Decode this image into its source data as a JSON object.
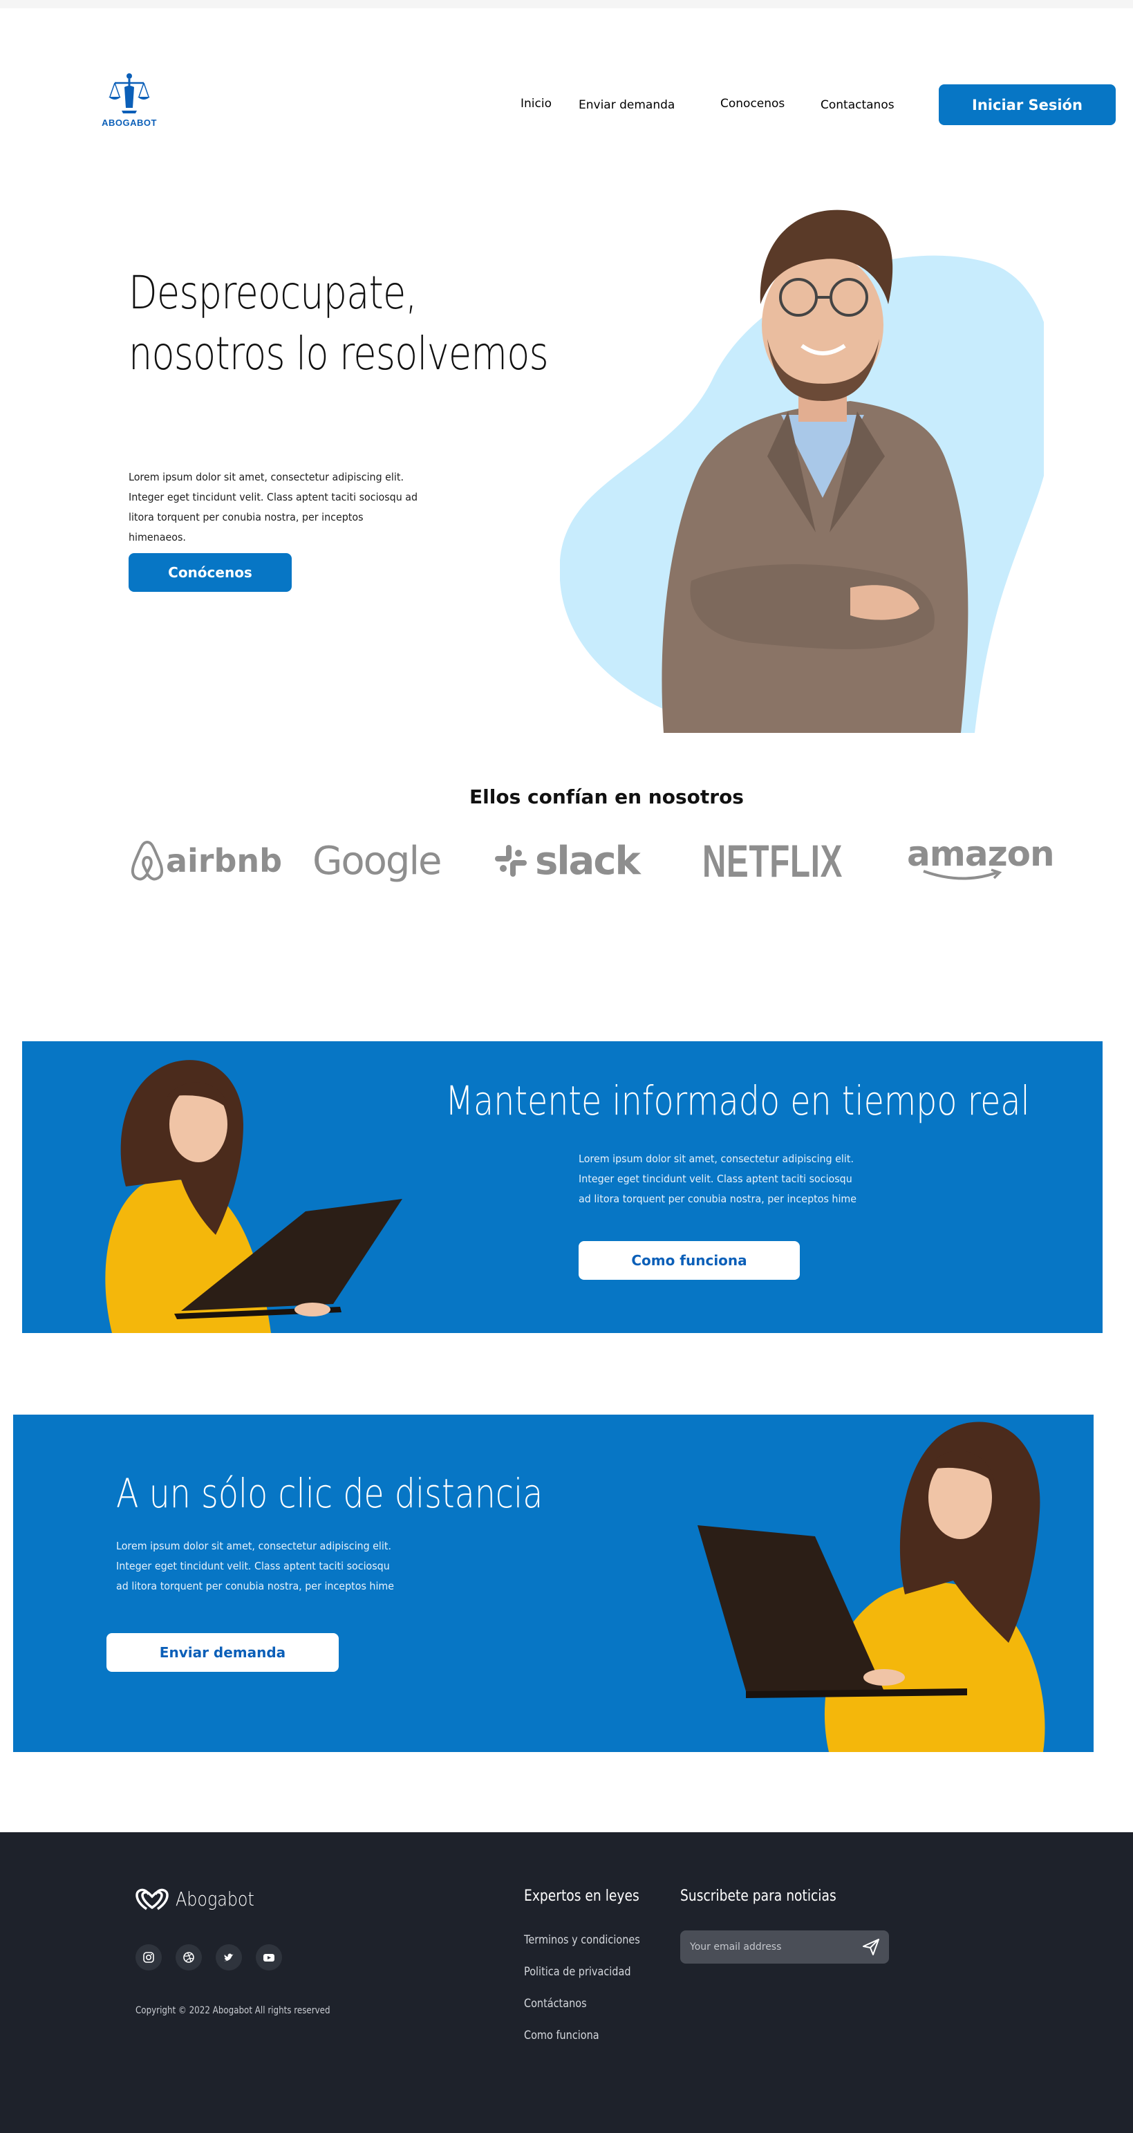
{
  "header": {
    "logo_text": "ABOGABOT",
    "nav": [
      "Inicio",
      "Enviar demanda",
      "Conocenos",
      "Contactanos"
    ],
    "login_label": "Iniciar Sesión"
  },
  "hero": {
    "title_line1": "Despreocupate,",
    "title_line2": "nosotros lo resolvemos",
    "body": "Lorem ipsum dolor sit amet, consectetur adipiscing elit. Integer eget tincidunt velit. Class aptent taciti sociosqu ad litora torquent per conubia nostra, per inceptos himenaeos.",
    "button_label": "Conócenos"
  },
  "trust": {
    "title": "Ellos confían en nosotros",
    "brands": [
      "airbnb",
      "Google",
      "slack",
      "NETFLIX",
      "amazon"
    ]
  },
  "band1": {
    "title": "Mantente informado en tiempo real",
    "body": "Lorem ipsum dolor sit amet, consectetur adipiscing elit. Integer eget tincidunt velit. Class aptent taciti sociosqu ad litora torquent per conubia nostra, per inceptos hime",
    "button_label": "Como funciona"
  },
  "band2": {
    "title": "A un sólo clic de distancia",
    "body": "Lorem ipsum dolor sit amet, consectetur adipiscing elit. Integer eget tincidunt velit. Class aptent taciti sociosqu ad litora torquent per conubia nostra, per inceptos hime",
    "button_label": "Enviar demanda"
  },
  "footer": {
    "brand": "Abogabot",
    "socials": [
      "instagram-icon",
      "dribbble-icon",
      "twitter-icon",
      "youtube-icon"
    ],
    "copyright": "Copyright © 2022 Abogabot All rights reserved",
    "col1_title": "Expertos en leyes",
    "links": [
      "Terminos y condiciones",
      "Politica de privacidad",
      "Contáctanos",
      "Como funciona"
    ],
    "col2_title": "Suscribete para noticias",
    "email_placeholder": "Your email address"
  },
  "colors": {
    "primary": "#0776c5",
    "blob": "#c8ecfd",
    "footer_bg": "#1e222b",
    "brand_gray": "#8e8e8e"
  }
}
